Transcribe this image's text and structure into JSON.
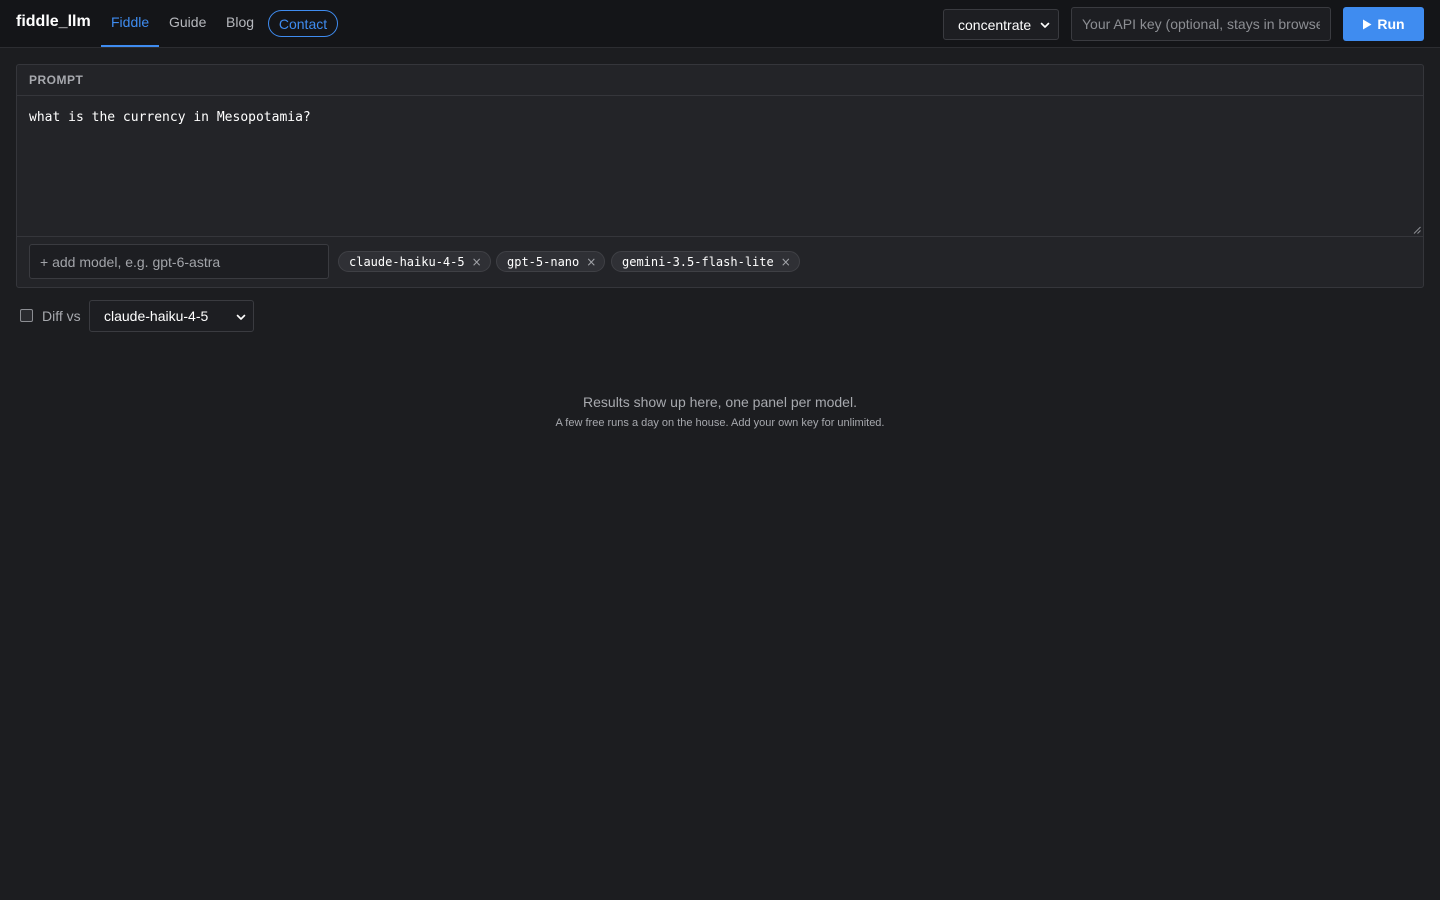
{
  "header": {
    "brand": "fiddle_llm",
    "nav": [
      {
        "label": "Fiddle",
        "active": true
      },
      {
        "label": "Guide",
        "active": false
      },
      {
        "label": "Blog",
        "active": false
      }
    ],
    "contact_label": "Contact",
    "mode_select": {
      "value": "concentrate",
      "icon": "chevron-down-icon"
    },
    "api_key": {
      "value": "",
      "placeholder": "Your API key (optional, stays in browser)"
    },
    "run_label": "Run",
    "run_icon": "play-icon"
  },
  "prompt": {
    "header": "PROMPT",
    "text": "what is the currency in Mesopotamia?",
    "model_input": {
      "value": "",
      "placeholder": "+ add model, e.g. gpt-6-astra"
    },
    "models": [
      "claude-haiku-4-5",
      "gpt-5-nano",
      "gemini-3.5-flash-lite"
    ],
    "remove_glyph": "×"
  },
  "diff": {
    "checked": false,
    "label": "Diff vs",
    "selected_model": "claude-haiku-4-5"
  },
  "empty_state": {
    "title": "Results show up here, one panel per model.",
    "subtitle": "A few free runs a day on the house. Add your own key for unlimited."
  },
  "colors": {
    "accent": "#3f8cf0",
    "background": "#1c1d20",
    "topbar": "#141518",
    "card": "#232428"
  }
}
